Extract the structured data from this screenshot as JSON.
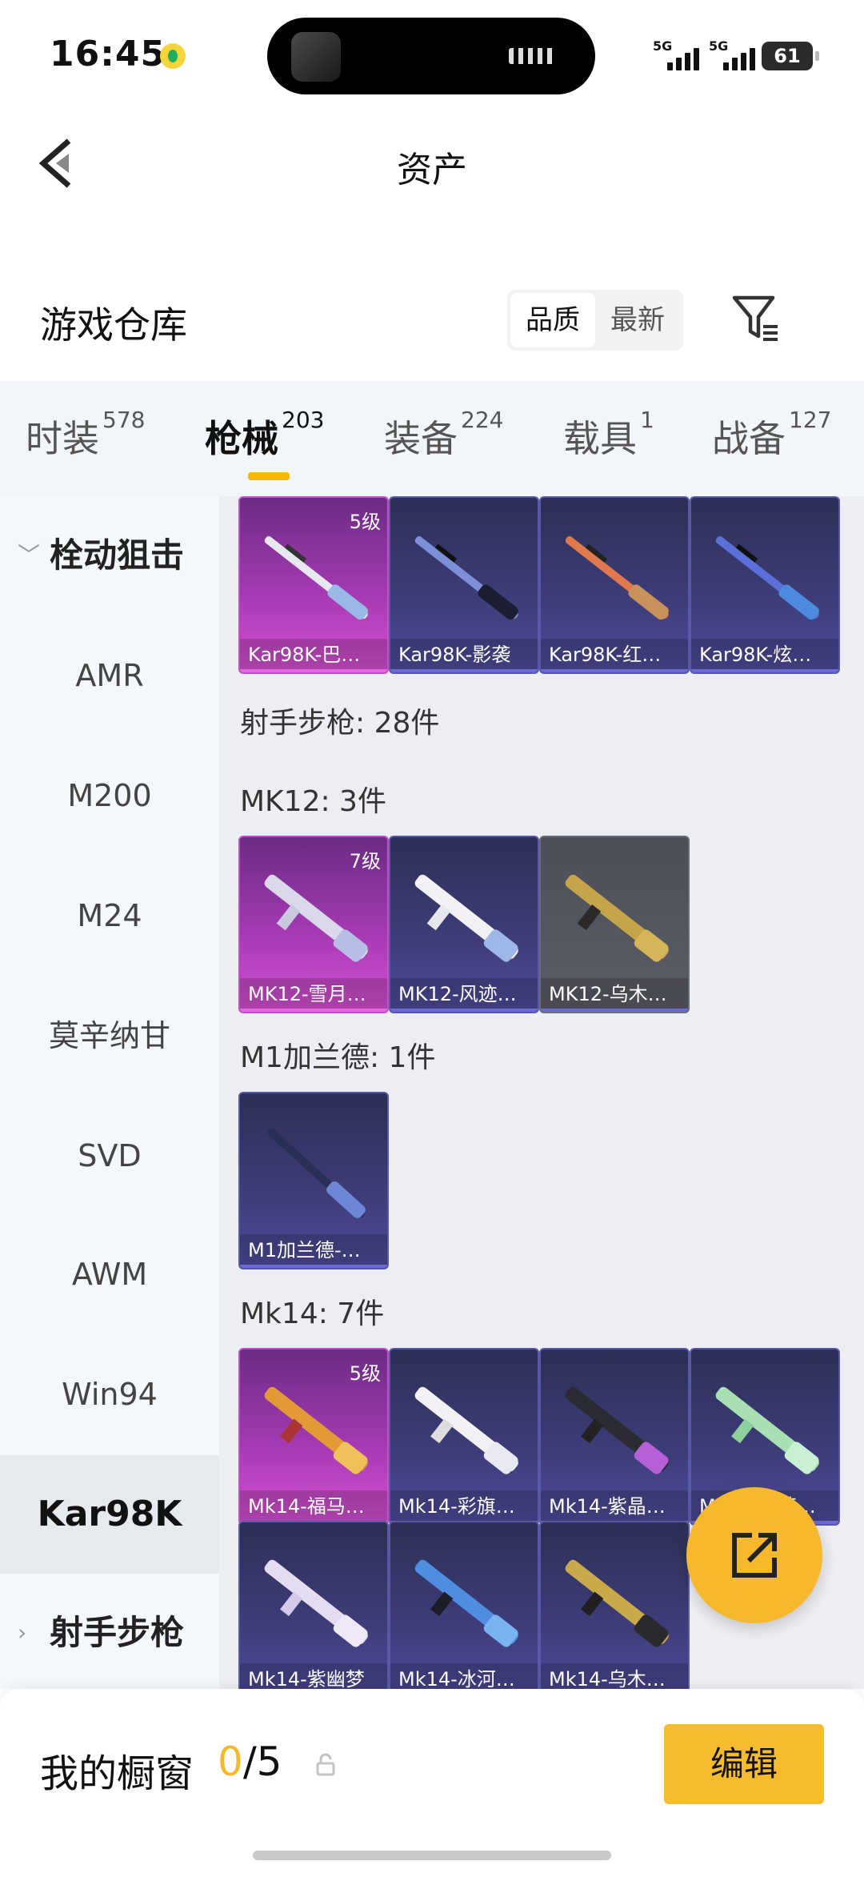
{
  "status_bar": {
    "time": "16:45",
    "signal_1": "5G",
    "signal_2": "5G",
    "battery": "61"
  },
  "header": {
    "title": "资产"
  },
  "section": {
    "title": "游戏仓库",
    "sort_options": [
      "品质",
      "最新"
    ],
    "active_sort": "品质"
  },
  "tabs": [
    {
      "label": "时装",
      "count": "578"
    },
    {
      "label": "枪械",
      "count": "203"
    },
    {
      "label": "装备",
      "count": "224"
    },
    {
      "label": "载具",
      "count": "1"
    },
    {
      "label": "战备",
      "count": "127"
    }
  ],
  "active_tab": "枪械",
  "sidebar": {
    "items": [
      {
        "label": "栓动狙击",
        "type": "group"
      },
      {
        "label": "AMR"
      },
      {
        "label": "M200"
      },
      {
        "label": "M24"
      },
      {
        "label": "莫辛纳甘"
      },
      {
        "label": "SVD"
      },
      {
        "label": "AWM"
      },
      {
        "label": "Win94"
      },
      {
        "label": "Kar98K",
        "selected": true
      },
      {
        "label": "射手步枪",
        "type": "group"
      }
    ]
  },
  "content": {
    "kar98k_row": [
      {
        "name": "Kar98K-巴…",
        "level": "5级",
        "rarity": "pink"
      },
      {
        "name": "Kar98K-影袭",
        "level": "",
        "rarity": "purple"
      },
      {
        "name": "Kar98K-红…",
        "level": "",
        "rarity": "purple"
      },
      {
        "name": "Kar98K-炫…",
        "level": "",
        "rarity": "purple"
      }
    ],
    "dmr_total": "射手步枪: 28件",
    "mk12_label": "MK12: 3件",
    "mk12": [
      {
        "name": "MK12-雪月…",
        "level": "7级",
        "rarity": "pink"
      },
      {
        "name": "MK12-风迹…",
        "level": "",
        "rarity": "purple"
      },
      {
        "name": "MK12-乌木…",
        "level": "",
        "rarity": "grey"
      }
    ],
    "m1_label": "M1加兰德: 1件",
    "m1": [
      {
        "name": "M1加兰德-…",
        "level": "",
        "rarity": "purple"
      }
    ],
    "mk14_label": "Mk14: 7件",
    "mk14": [
      {
        "name": "Mk14-福马…",
        "level": "5级",
        "rarity": "pink"
      },
      {
        "name": "Mk14-彩旗…",
        "level": "",
        "rarity": "purple"
      },
      {
        "name": "Mk14-紫晶…",
        "level": "",
        "rarity": "purple"
      },
      {
        "name": "Mk14-薄荷…",
        "level": "",
        "rarity": "purple"
      },
      {
        "name": "Mk14-紫幽梦",
        "level": "",
        "rarity": "purple"
      },
      {
        "name": "Mk14-冰河…",
        "level": "",
        "rarity": "purple"
      },
      {
        "name": "Mk14-乌木…",
        "level": "",
        "rarity": "purple"
      }
    ]
  },
  "bottom": {
    "title": "我的橱窗",
    "current": "0",
    "total": "/5",
    "edit_label": "编辑"
  },
  "colors": {
    "accent": "#f6b92e",
    "tab_indicator": "#f6b800",
    "card_purple": "#3e3d7a",
    "card_pink": "#a53ab3",
    "card_grey": "#5a5c66"
  }
}
